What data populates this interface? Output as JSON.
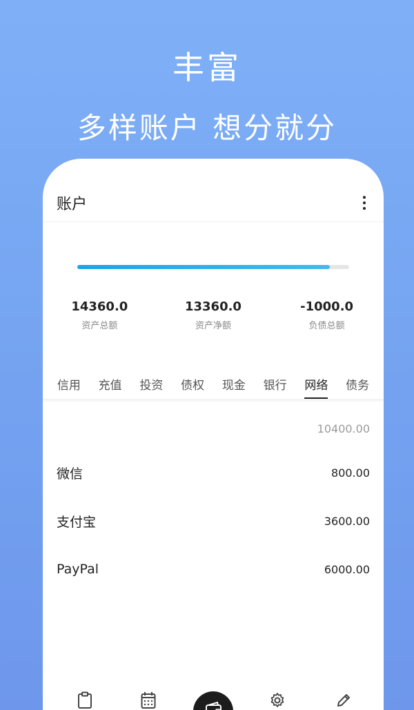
{
  "hero": {
    "title": "丰富",
    "subtitle": "多样账户 想分就分"
  },
  "appbar": {
    "title": "账户",
    "more_icon": "more-vertical-icon"
  },
  "progress": {
    "fraction": 0.93,
    "color": "#1ea2e8"
  },
  "stats": [
    {
      "value": "14360.0",
      "label": "资产总额"
    },
    {
      "value": "13360.0",
      "label": "资产净额"
    },
    {
      "value": "-1000.0",
      "label": "负债总额"
    }
  ],
  "tabs": [
    {
      "label": "信用",
      "active": false
    },
    {
      "label": "充值",
      "active": false
    },
    {
      "label": "投资",
      "active": false
    },
    {
      "label": "债权",
      "active": false
    },
    {
      "label": "现金",
      "active": false
    },
    {
      "label": "银行",
      "active": false
    },
    {
      "label": "网络",
      "active": true
    },
    {
      "label": "债务",
      "active": false
    }
  ],
  "section_total": "10400.00",
  "accounts": [
    {
      "name": "微信",
      "amount": "800.00"
    },
    {
      "name": "支付宝",
      "amount": "3600.00"
    },
    {
      "name": "PayPal",
      "amount": "6000.00"
    }
  ],
  "bottom_nav": [
    {
      "icon": "clipboard-icon"
    },
    {
      "icon": "calendar-icon"
    },
    {
      "icon": "wallet-icon",
      "active": true
    },
    {
      "icon": "gear-icon"
    },
    {
      "icon": "pencil-icon"
    }
  ]
}
